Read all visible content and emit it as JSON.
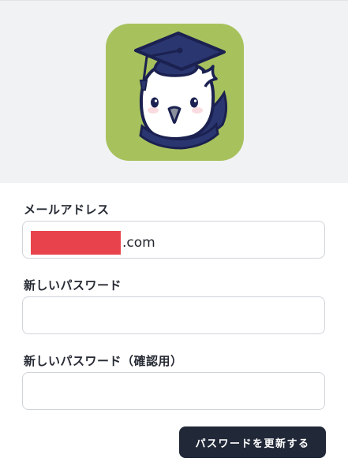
{
  "colors": {
    "header_bg": "#f1f2f4",
    "logo_bg": "#a7c25d",
    "button_bg": "#212838",
    "button_text": "#ffffff",
    "redaction": "#e8434c"
  },
  "app": {
    "logo_icon": "owl-graduation-cap-icon"
  },
  "form": {
    "email_label": "メールアドレス",
    "email_value_suffix": ".com",
    "new_password_label": "新しいパスワード",
    "new_password_value": "",
    "confirm_password_label": "新しいパスワード（確認用）",
    "confirm_password_value": "",
    "submit_label": "パスワードを更新する"
  }
}
